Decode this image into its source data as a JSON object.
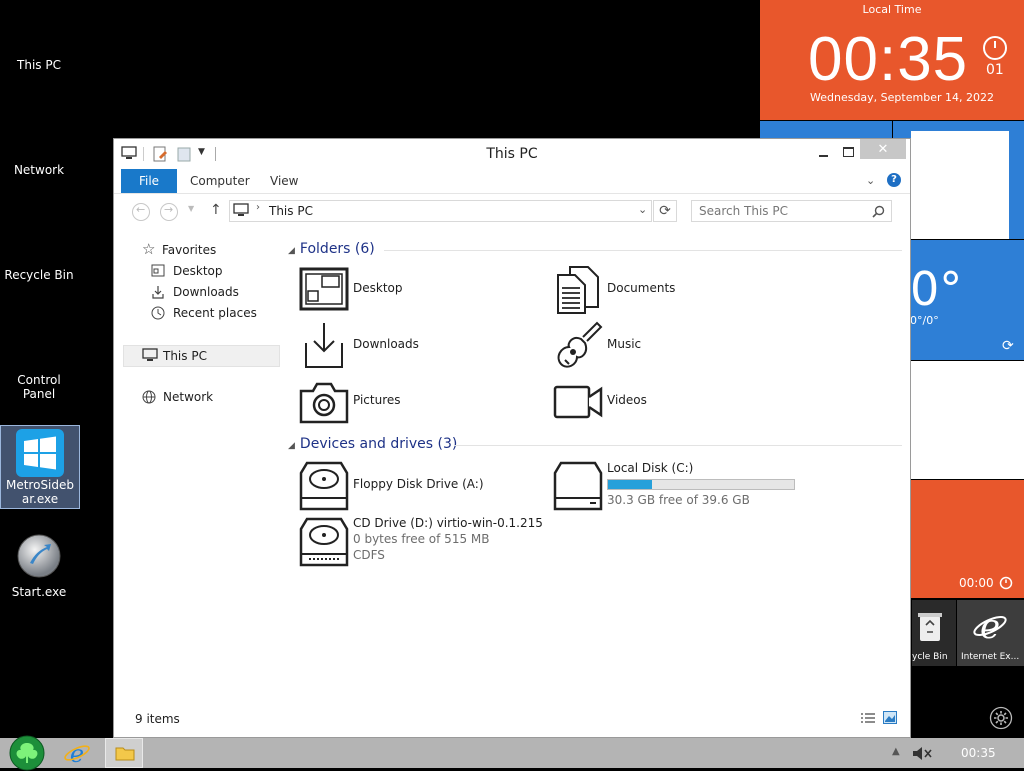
{
  "desktop": {
    "icons": [
      {
        "label": "This PC"
      },
      {
        "label": "Network"
      },
      {
        "label": "Recycle Bin"
      },
      {
        "label": "Control Panel"
      },
      {
        "label": "MetroSidebar.exe"
      },
      {
        "label": "Start.exe"
      }
    ]
  },
  "sidebar": {
    "clock": {
      "header": "Local Time",
      "time": "00:35",
      "seconds": "01",
      "date": "Wednesday, September 14, 2022"
    },
    "weather": {
      "temp": "0°",
      "range": "0°/0°"
    },
    "timer": {
      "value": "00:00"
    },
    "bottom_tiles": [
      {
        "label": "ycle Bin"
      },
      {
        "label": "Internet Ex..."
      }
    ],
    "colors": {
      "clock_bg": "#e8572c",
      "weather_bg": "#2e7fd6",
      "timer_bg": "#e8572c",
      "tile_dark": "#2a2a2a"
    }
  },
  "window": {
    "title": "This PC",
    "ribbon": {
      "tabs": [
        "File",
        "Computer",
        "View"
      ]
    },
    "address": {
      "path": "This PC"
    },
    "search": {
      "placeholder": "Search This PC"
    },
    "nav": {
      "favorites": "Favorites",
      "favorite_items": [
        "Desktop",
        "Downloads",
        "Recent places"
      ],
      "this_pc": "This PC",
      "network": "Network"
    },
    "folders": {
      "header": "Folders (6)",
      "items": [
        "Desktop",
        "Documents",
        "Downloads",
        "Music",
        "Pictures",
        "Videos"
      ]
    },
    "drives": {
      "header": "Devices and drives (3)",
      "floppy": {
        "name": "Floppy Disk Drive (A:)"
      },
      "local": {
        "name": "Local Disk (C:)",
        "free": "30.3 GB free of 39.6 GB",
        "used_fraction": 0.235
      },
      "cd": {
        "name": "CD Drive (D:) virtio-win-0.1.215",
        "free": "0 bytes free of 515 MB",
        "fs": "CDFS"
      }
    },
    "status": {
      "items": "9 items"
    }
  },
  "taskbar": {
    "time": "00:35"
  }
}
